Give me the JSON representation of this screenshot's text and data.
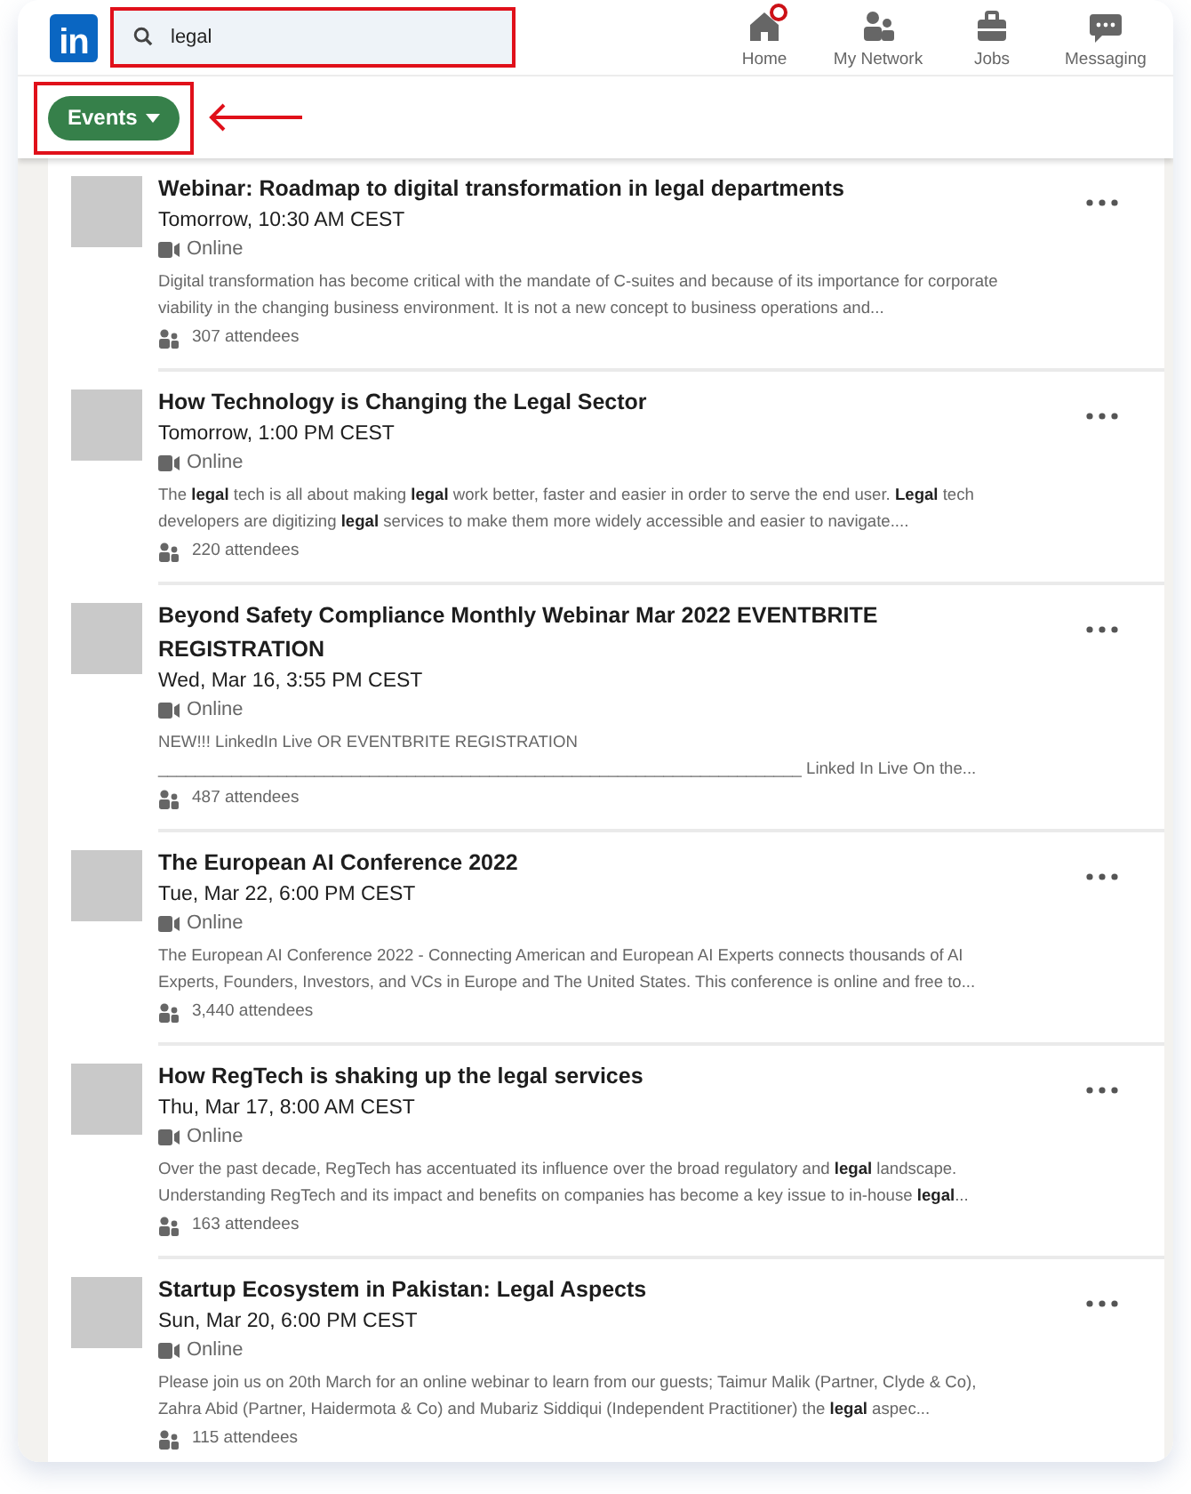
{
  "logo": "in",
  "search": {
    "value": "legal"
  },
  "nav": [
    {
      "label": "Home",
      "badge": true
    },
    {
      "label": "My Network",
      "badge": false
    },
    {
      "label": "Jobs",
      "badge": false
    },
    {
      "label": "Messaging",
      "badge": false
    }
  ],
  "filter": {
    "label": "Events"
  },
  "events": [
    {
      "kind": "event",
      "title": "Webinar: Roadmap to digital transformation in legal departments",
      "time": "Tomorrow, 10:30 AM CEST",
      "location": "Online",
      "description": "Digital transformation has become critical with the mandate of C-suites and because of its importance for corporate viability in the changing business environment. It is not a new concept to business operations and...",
      "attendees": "307 attendees"
    },
    {
      "kind": "event",
      "title": "How Technology is Changing the Legal Sector",
      "time": "Tomorrow, 1:00 PM CEST",
      "location": "Online",
      "description": "The **legal** tech is all about making **legal** work better, faster and easier in order to serve the end user. **Legal** tech developers are digitizing **legal** services to make them more widely accessible and easier to navigate....",
      "attendees": "220 attendees"
    },
    {
      "kind": "event",
      "title": "Beyond Safety Compliance Monthly Webinar Mar 2022 EVENTBRITE REGISTRATION",
      "time": "Wed, Mar 16, 3:55 PM CEST",
      "location": "Online",
      "description": "NEW!!! LinkedIn Live OR EVENTBRITE REGISTRATION ______________________________________________________________________ Linked In Live On the...",
      "attendees": "487 attendees"
    },
    {
      "kind": "event",
      "title": "The European AI Conference 2022",
      "time": "Tue, Mar 22, 6:00 PM CEST",
      "location": "Online",
      "description": "The European AI Conference 2022 - Connecting American and European AI Experts connects thousands of AI Experts, Founders, Investors, and VCs in Europe and The United States. This conference is online and free to...",
      "attendees": "3,440 attendees"
    },
    {
      "kind": "event",
      "title": "How RegTech is shaking up the legal services",
      "time": "Thu, Mar 17, 8:00 AM CEST",
      "location": "Online",
      "description": "Over the past decade, RegTech has accentuated its influence over the broad regulatory and **legal** landscape. Understanding RegTech and its impact and benefits on companies has become a key issue to in-house **legal**...",
      "attendees": "163 attendees"
    },
    {
      "kind": "event",
      "title": "Startup Ecosystem in Pakistan: Legal Aspects",
      "time": "Sun, Mar 20, 6:00 PM CEST",
      "location": "Online",
      "description": "Please join us on 20th March for an online webinar to learn from our guests; Taimur Malik (Partner, Clyde & Co), Zahra Abid (Partner, Haidermota & Co) and Mubariz Siddiqui (Independent Practitioner) the **legal** aspec...",
      "attendees": "115 attendees"
    },
    {
      "kind": "cut"
    }
  ]
}
